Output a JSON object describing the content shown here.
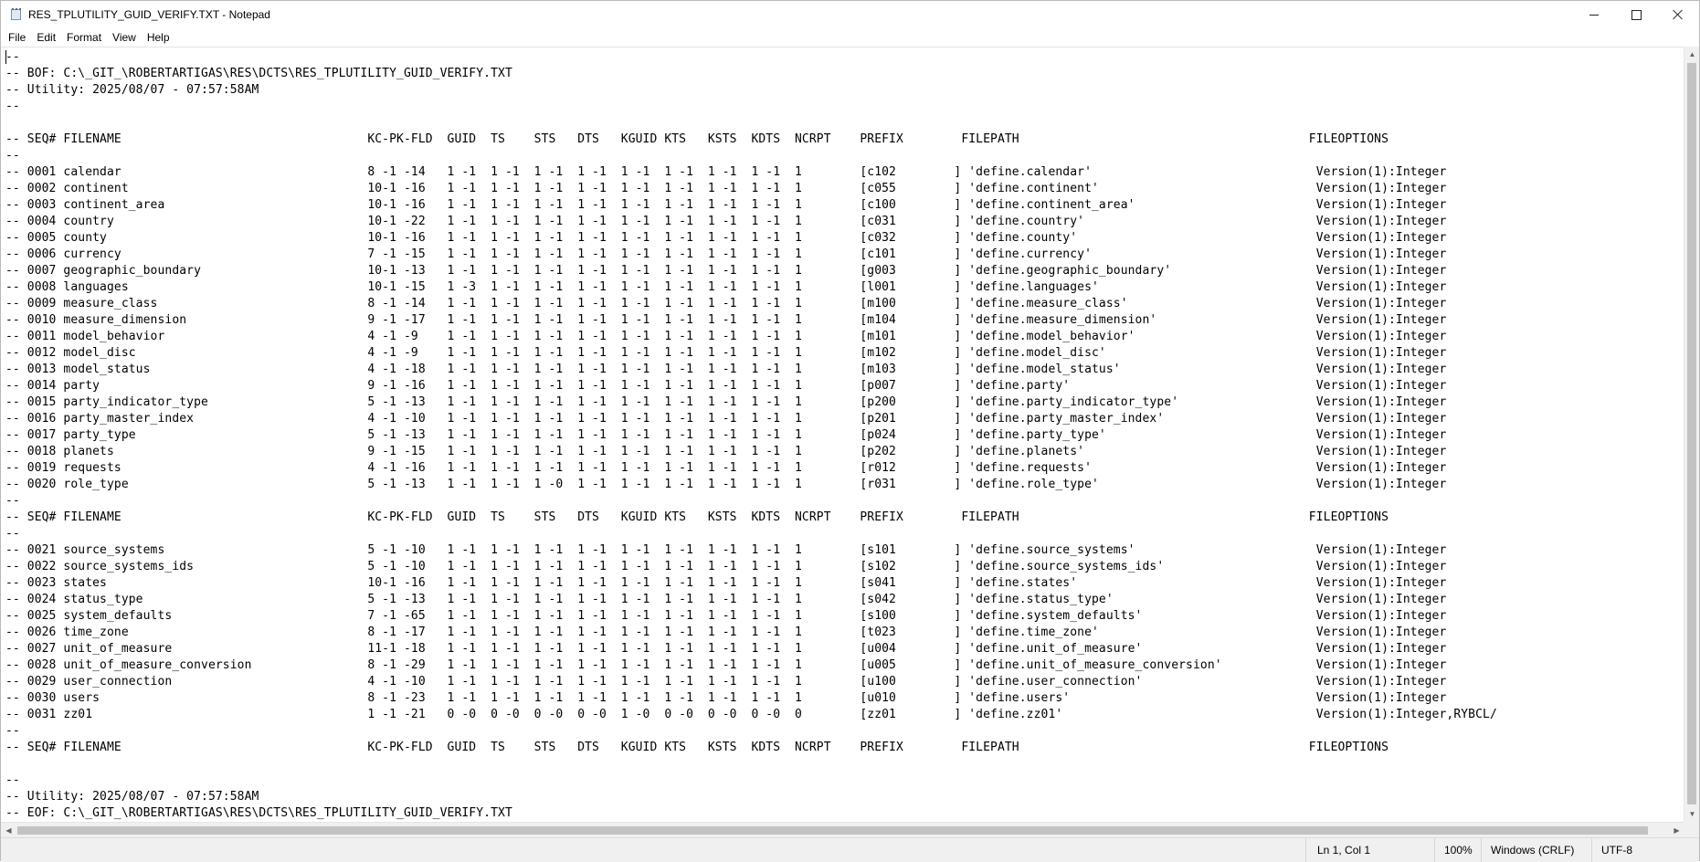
{
  "window": {
    "title": "RES_TPLUTILITY_GUID_VERIFY.TXT - Notepad"
  },
  "menu": {
    "file": "File",
    "edit": "Edit",
    "format": "Format",
    "view": "View",
    "help": "Help"
  },
  "editor": {
    "content": "--\n-- BOF: C:\\_GIT_\\ROBERTARTIGAS\\RES\\DCTS\\RES_TPLUTILITY_GUID_VERIFY.TXT\n-- Utility: 2025/08/07 - 07:57:58AM\n--\n\n-- SEQ# FILENAME                                  KC-PK-FLD  GUID  TS    STS   DTS   KGUID KTS   KSTS  KDTS  NCRPT    PREFIX        FILEPATH                                        FILEOPTIONS\n--\n-- 0001 calendar                                  8 -1 -14   1 -1  1 -1  1 -1  1 -1  1 -1  1 -1  1 -1  1 -1  1        [c102        ] 'define.calendar'                               Version(1):Integer\n-- 0002 continent                                 10-1 -16   1 -1  1 -1  1 -1  1 -1  1 -1  1 -1  1 -1  1 -1  1        [c055        ] 'define.continent'                              Version(1):Integer\n-- 0003 continent_area                            10-1 -16   1 -1  1 -1  1 -1  1 -1  1 -1  1 -1  1 -1  1 -1  1        [c100        ] 'define.continent_area'                         Version(1):Integer\n-- 0004 country                                   10-1 -22   1 -1  1 -1  1 -1  1 -1  1 -1  1 -1  1 -1  1 -1  1        [c031        ] 'define.country'                                Version(1):Integer\n-- 0005 county                                    10-1 -16   1 -1  1 -1  1 -1  1 -1  1 -1  1 -1  1 -1  1 -1  1        [c032        ] 'define.county'                                 Version(1):Integer\n-- 0006 currency                                  7 -1 -15   1 -1  1 -1  1 -1  1 -1  1 -1  1 -1  1 -1  1 -1  1        [c101        ] 'define.currency'                               Version(1):Integer\n-- 0007 geographic_boundary                       10-1 -13   1 -1  1 -1  1 -1  1 -1  1 -1  1 -1  1 -1  1 -1  1        [g003        ] 'define.geographic_boundary'                    Version(1):Integer\n-- 0008 languages                                 10-1 -15   1 -3  1 -1  1 -1  1 -1  1 -1  1 -1  1 -1  1 -1  1        [l001        ] 'define.languages'                              Version(1):Integer\n-- 0009 measure_class                             8 -1 -14   1 -1  1 -1  1 -1  1 -1  1 -1  1 -1  1 -1  1 -1  1        [m100        ] 'define.measure_class'                          Version(1):Integer\n-- 0010 measure_dimension                         9 -1 -17   1 -1  1 -1  1 -1  1 -1  1 -1  1 -1  1 -1  1 -1  1        [m104        ] 'define.measure_dimension'                      Version(1):Integer\n-- 0011 model_behavior                            4 -1 -9    1 -1  1 -1  1 -1  1 -1  1 -1  1 -1  1 -1  1 -1  1        [m101        ] 'define.model_behavior'                         Version(1):Integer\n-- 0012 model_disc                                4 -1 -9    1 -1  1 -1  1 -1  1 -1  1 -1  1 -1  1 -1  1 -1  1        [m102        ] 'define.model_disc'                             Version(1):Integer\n-- 0013 model_status                              4 -1 -18   1 -1  1 -1  1 -1  1 -1  1 -1  1 -1  1 -1  1 -1  1        [m103        ] 'define.model_status'                           Version(1):Integer\n-- 0014 party                                     9 -1 -16   1 -1  1 -1  1 -1  1 -1  1 -1  1 -1  1 -1  1 -1  1        [p007        ] 'define.party'                                  Version(1):Integer\n-- 0015 party_indicator_type                      5 -1 -13   1 -1  1 -1  1 -1  1 -1  1 -1  1 -1  1 -1  1 -1  1        [p200        ] 'define.party_indicator_type'                   Version(1):Integer\n-- 0016 party_master_index                        4 -1 -10   1 -1  1 -1  1 -1  1 -1  1 -1  1 -1  1 -1  1 -1  1        [p201        ] 'define.party_master_index'                     Version(1):Integer\n-- 0017 party_type                                5 -1 -13   1 -1  1 -1  1 -1  1 -1  1 -1  1 -1  1 -1  1 -1  1        [p024        ] 'define.party_type'                             Version(1):Integer\n-- 0018 planets                                   9 -1 -15   1 -1  1 -1  1 -1  1 -1  1 -1  1 -1  1 -1  1 -1  1        [p202        ] 'define.planets'                                Version(1):Integer\n-- 0019 requests                                  4 -1 -16   1 -1  1 -1  1 -1  1 -1  1 -1  1 -1  1 -1  1 -1  1        [r012        ] 'define.requests'                               Version(1):Integer\n-- 0020 role_type                                 5 -1 -13   1 -1  1 -1  1 -0  1 -1  1 -1  1 -1  1 -1  1 -1  1        [r031        ] 'define.role_type'                              Version(1):Integer\n--\n-- SEQ# FILENAME                                  KC-PK-FLD  GUID  TS    STS   DTS   KGUID KTS   KSTS  KDTS  NCRPT    PREFIX        FILEPATH                                        FILEOPTIONS\n--\n-- 0021 source_systems                            5 -1 -10   1 -1  1 -1  1 -1  1 -1  1 -1  1 -1  1 -1  1 -1  1        [s101        ] 'define.source_systems'                         Version(1):Integer\n-- 0022 source_systems_ids                        5 -1 -10   1 -1  1 -1  1 -1  1 -1  1 -1  1 -1  1 -1  1 -1  1        [s102        ] 'define.source_systems_ids'                     Version(1):Integer\n-- 0023 states                                    10-1 -16   1 -1  1 -1  1 -1  1 -1  1 -1  1 -1  1 -1  1 -1  1        [s041        ] 'define.states'                                 Version(1):Integer\n-- 0024 status_type                               5 -1 -13   1 -1  1 -1  1 -1  1 -1  1 -1  1 -1  1 -1  1 -1  1        [s042        ] 'define.status_type'                            Version(1):Integer\n-- 0025 system_defaults                           7 -1 -65   1 -1  1 -1  1 -1  1 -1  1 -1  1 -1  1 -1  1 -1  1        [s100        ] 'define.system_defaults'                        Version(1):Integer\n-- 0026 time_zone                                 8 -1 -17   1 -1  1 -1  1 -1  1 -1  1 -1  1 -1  1 -1  1 -1  1        [t023        ] 'define.time_zone'                              Version(1):Integer\n-- 0027 unit_of_measure                           11-1 -18   1 -1  1 -1  1 -1  1 -1  1 -1  1 -1  1 -1  1 -1  1        [u004        ] 'define.unit_of_measure'                        Version(1):Integer\n-- 0028 unit_of_measure_conversion                8 -1 -29   1 -1  1 -1  1 -1  1 -1  1 -1  1 -1  1 -1  1 -1  1        [u005        ] 'define.unit_of_measure_conversion'             Version(1):Integer\n-- 0029 user_connection                           4 -1 -10   1 -1  1 -1  1 -1  1 -1  1 -1  1 -1  1 -1  1 -1  1        [u100        ] 'define.user_connection'                        Version(1):Integer\n-- 0030 users                                     8 -1 -23   1 -1  1 -1  1 -1  1 -1  1 -1  1 -1  1 -1  1 -1  1        [u010        ] 'define.users'                                  Version(1):Integer\n-- 0031 zz01                                      1 -1 -21   0 -0  0 -0  0 -0  0 -0  1 -0  0 -0  0 -0  0 -0  0        [zz01        ] 'define.zz01'                                   Version(1):Integer,RYBCL/\n--\n-- SEQ# FILENAME                                  KC-PK-FLD  GUID  TS    STS   DTS   KGUID KTS   KSTS  KDTS  NCRPT    PREFIX        FILEPATH                                        FILEOPTIONS\n\n--\n-- Utility: 2025/08/07 - 07:57:58AM\n-- EOF: C:\\_GIT_\\ROBERTARTIGAS\\RES\\DCTS\\RES_TPLUTILITY_GUID_VERIFY.TXT"
  },
  "status": {
    "position": "Ln 1, Col 1",
    "zoom": "100%",
    "line_ending": "Windows (CRLF)",
    "encoding": "UTF-8"
  },
  "icons": {
    "app": "notepad-icon",
    "minimize": "minimize-icon",
    "maximize": "maximize-icon",
    "close": "close-icon"
  }
}
